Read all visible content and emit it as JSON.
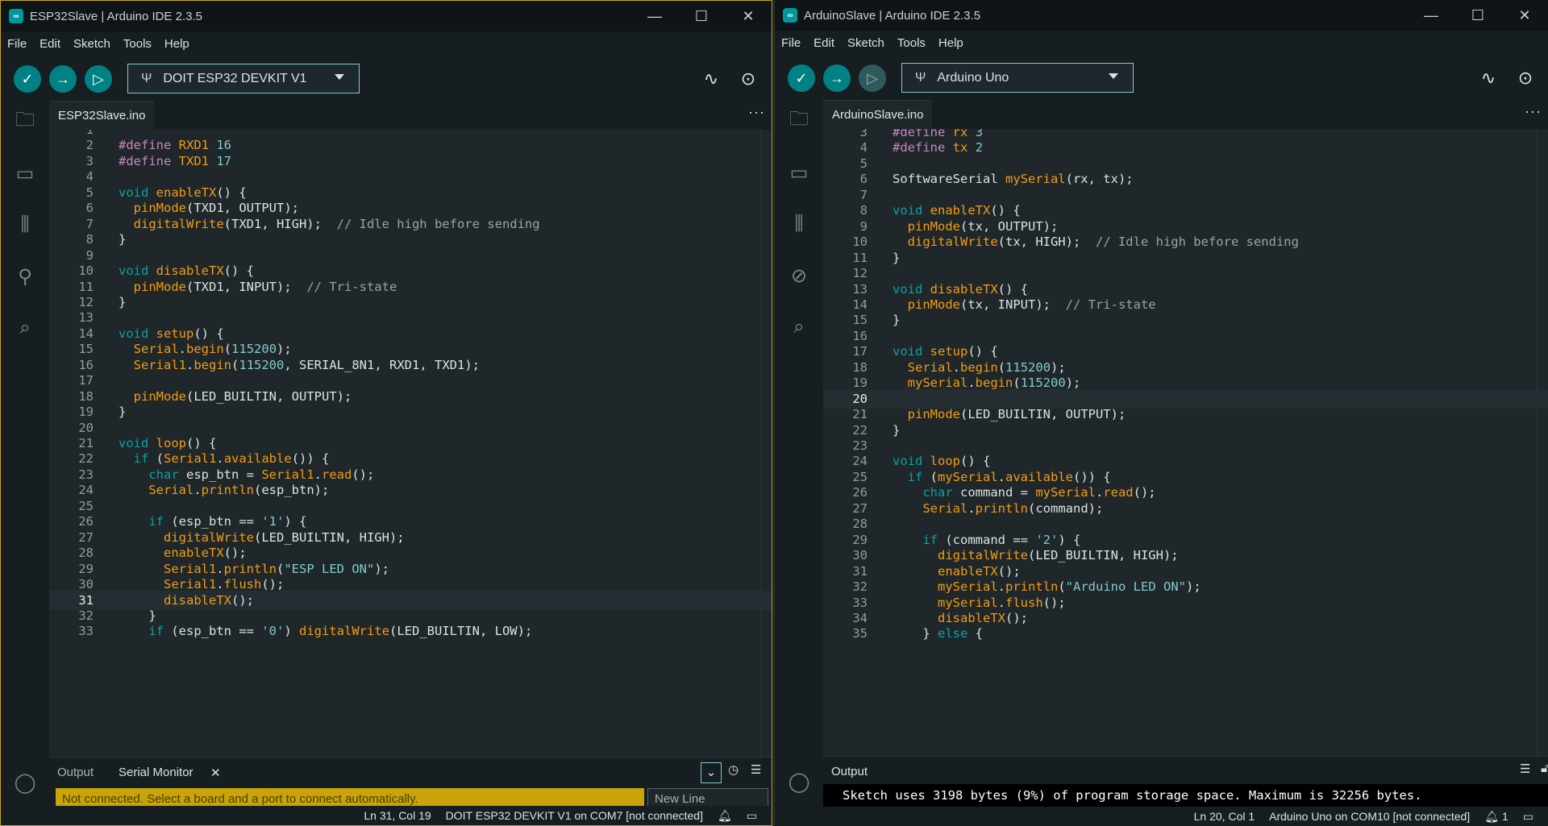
{
  "menu": [
    "File",
    "Edit",
    "Sketch",
    "Tools",
    "Help"
  ],
  "left": {
    "title": "ESP32Slave | Arduino IDE 2.3.5",
    "board": "DOIT ESP32 DEVKIT V1",
    "tab": "ESP32Slave.ino",
    "bottom_tabs": [
      "Output",
      "Serial Monitor"
    ],
    "notification": "Not connected. Select a board and a port to connect automatically.",
    "line_ending": "New Line",
    "status": {
      "position": "Ln 31, Col 19",
      "board": "DOIT ESP32 DEVKIT V1 on COM7 [not connected]"
    },
    "current_line": "31",
    "lines": [
      [
        "1",
        ""
      ],
      [
        "2",
        "<span class=\"pp\">#define</span> <span class=\"fn\">RXD1</span> <span class=\"num\">16</span>"
      ],
      [
        "3",
        "<span class=\"pp\">#define</span> <span class=\"fn\">TXD1</span> <span class=\"num\">17</span>"
      ],
      [
        "4",
        ""
      ],
      [
        "5",
        "<span class=\"kw\">void</span> <span class=\"fn\">enableTX</span>() {"
      ],
      [
        "6",
        "  <span class=\"fn\">pinMode</span>(TXD1, OUTPUT);"
      ],
      [
        "7",
        "  <span class=\"fn\">digitalWrite</span>(TXD1, HIGH);  <span class=\"cm\">// Idle high before sending</span>"
      ],
      [
        "8",
        "}"
      ],
      [
        "9",
        ""
      ],
      [
        "10",
        "<span class=\"kw\">void</span> <span class=\"fn\">disableTX</span>() {"
      ],
      [
        "11",
        "  <span class=\"fn\">pinMode</span>(TXD1, INPUT);  <span class=\"cm\">// Tri-state</span>"
      ],
      [
        "12",
        "}"
      ],
      [
        "13",
        ""
      ],
      [
        "14",
        "<span class=\"kw\">void</span> <span class=\"fn\">setup</span>() {"
      ],
      [
        "15",
        "  <span class=\"fn\">Serial</span>.<span class=\"fn\">begin</span>(<span class=\"num\">115200</span>);"
      ],
      [
        "16",
        "  <span class=\"fn\">Serial1</span>.<span class=\"fn\">begin</span>(<span class=\"num\">115200</span>, SERIAL_8N1, RXD1, TXD1);"
      ],
      [
        "17",
        ""
      ],
      [
        "18",
        "  <span class=\"fn\">pinMode</span>(LED_BUILTIN, OUTPUT);"
      ],
      [
        "19",
        "}"
      ],
      [
        "20",
        ""
      ],
      [
        "21",
        "<span class=\"kw\">void</span> <span class=\"fn\">loop</span>() {"
      ],
      [
        "22",
        "  <span class=\"kw\">if</span> (<span class=\"fn\">Serial1</span>.<span class=\"fn\">available</span>()) {"
      ],
      [
        "23",
        "    <span class=\"kw\">char</span> esp_btn = <span class=\"fn\">Serial1</span>.<span class=\"fn\">read</span>();"
      ],
      [
        "24",
        "    <span class=\"fn\">Serial</span>.<span class=\"fn\">println</span>(esp_btn);"
      ],
      [
        "25",
        ""
      ],
      [
        "26",
        "    <span class=\"kw\">if</span> (esp_btn == <span class=\"str\">'1'</span>) {"
      ],
      [
        "27",
        "      <span class=\"fn\">digitalWrite</span>(LED_BUILTIN, HIGH);"
      ],
      [
        "28",
        "      <span class=\"fn\">enableTX</span>();"
      ],
      [
        "29",
        "      <span class=\"fn\">Serial1</span>.<span class=\"fn\">println</span>(<span class=\"str\">\"ESP LED ON\"</span>);"
      ],
      [
        "30",
        "      <span class=\"fn\">Serial1</span>.<span class=\"fn\">flush</span>();"
      ],
      [
        "31",
        "      <span class=\"fn\">disableTX</span>();"
      ],
      [
        "32",
        "    }"
      ],
      [
        "33",
        "    <span class=\"kw\">if</span> (esp_btn == <span class=\"str\">'0'</span>) <span class=\"fn\">digitalWrite</span>(LED_BUILTIN, LOW);"
      ]
    ]
  },
  "right": {
    "title": "ArduinoSlave | Arduino IDE 2.3.5",
    "board": "Arduino Uno",
    "tab": "ArduinoSlave.ino",
    "bottom_tabs": [
      "Output"
    ],
    "output": "Sketch uses 3198 bytes (9%) of program storage space. Maximum is 32256 bytes.",
    "status": {
      "position": "Ln 20, Col 1",
      "board": "Arduino Uno on COM10 [not connected]",
      "notifications": "1"
    },
    "current_line": "20",
    "lines": [
      [
        "3",
        "<span class=\"pp\">#define</span> <span class=\"fn\">rx</span> <span class=\"num\">3</span>"
      ],
      [
        "4",
        "<span class=\"pp\">#define</span> <span class=\"fn\">tx</span> <span class=\"num\">2</span>"
      ],
      [
        "5",
        ""
      ],
      [
        "6",
        "SoftwareSerial <span class=\"fn\">mySerial</span>(rx, tx);"
      ],
      [
        "7",
        ""
      ],
      [
        "8",
        "<span class=\"kw\">void</span> <span class=\"fn\">enableTX</span>() {"
      ],
      [
        "9",
        "  <span class=\"fn\">pinMode</span>(tx, OUTPUT);"
      ],
      [
        "10",
        "  <span class=\"fn\">digitalWrite</span>(tx, HIGH);  <span class=\"cm\">// Idle high before sending</span>"
      ],
      [
        "11",
        "}"
      ],
      [
        "12",
        ""
      ],
      [
        "13",
        "<span class=\"kw\">void</span> <span class=\"fn\">disableTX</span>() {"
      ],
      [
        "14",
        "  <span class=\"fn\">pinMode</span>(tx, INPUT);  <span class=\"cm\">// Tri-state</span>"
      ],
      [
        "15",
        "}"
      ],
      [
        "16",
        ""
      ],
      [
        "17",
        "<span class=\"kw\">void</span> <span class=\"fn\">setup</span>() {"
      ],
      [
        "18",
        "  <span class=\"fn\">Serial</span>.<span class=\"fn\">begin</span>(<span class=\"num\">115200</span>);"
      ],
      [
        "19",
        "  <span class=\"fn\">mySerial</span>.<span class=\"fn\">begin</span>(<span class=\"num\">115200</span>);"
      ],
      [
        "20",
        ""
      ],
      [
        "21",
        "  <span class=\"fn\">pinMode</span>(LED_BUILTIN, OUTPUT);"
      ],
      [
        "22",
        "}"
      ],
      [
        "23",
        ""
      ],
      [
        "24",
        "<span class=\"kw\">void</span> <span class=\"fn\">loop</span>() {"
      ],
      [
        "25",
        "  <span class=\"kw\">if</span> (<span class=\"fn\">mySerial</span>.<span class=\"fn\">available</span>()) {"
      ],
      [
        "26",
        "    <span class=\"kw\">char</span> command = <span class=\"fn\">mySerial</span>.<span class=\"fn\">read</span>();"
      ],
      [
        "27",
        "    <span class=\"fn\">Serial</span>.<span class=\"fn\">println</span>(command);"
      ],
      [
        "28",
        ""
      ],
      [
        "29",
        "    <span class=\"kw\">if</span> (command == <span class=\"str\">'2'</span>) {"
      ],
      [
        "30",
        "      <span class=\"fn\">digitalWrite</span>(LED_BUILTIN, HIGH);"
      ],
      [
        "31",
        "      <span class=\"fn\">enableTX</span>();"
      ],
      [
        "32",
        "      <span class=\"fn\">mySerial</span>.<span class=\"fn\">println</span>(<span class=\"str\">\"Arduino LED ON\"</span>);"
      ],
      [
        "33",
        "      <span class=\"fn\">mySerial</span>.<span class=\"fn\">flush</span>();"
      ],
      [
        "34",
        "      <span class=\"fn\">disableTX</span>();"
      ],
      [
        "35",
        "    } <span class=\"kw\">else</span> {"
      ]
    ]
  }
}
